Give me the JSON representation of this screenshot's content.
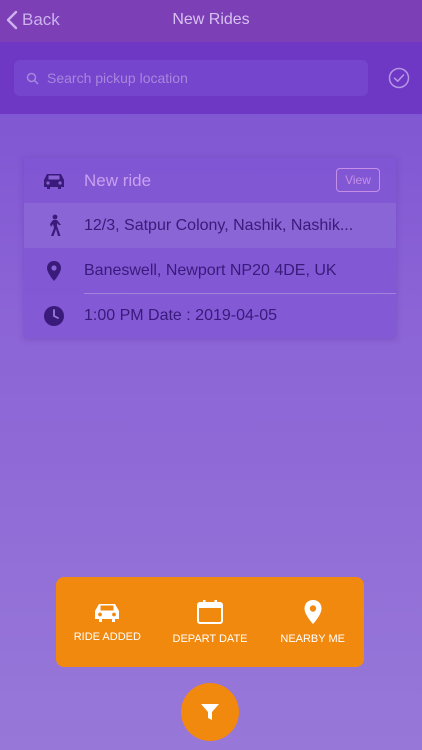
{
  "nav": {
    "back_label": "Back",
    "title": "New Rides"
  },
  "search": {
    "placeholder": "Search pickup location"
  },
  "ride": {
    "header": "New ride",
    "view_label": "View",
    "pickup": "12/3, Satpur Colony, Nashik, Nashik...",
    "drop": "Baneswell, Newport NP20 4DE, UK",
    "time": "1:00 PM Date : 2019-04-05"
  },
  "filters": {
    "ride_added": "RIDE ADDED",
    "depart_date": "DEPART DATE",
    "nearby_me": "NEARBY ME"
  },
  "colors": {
    "accent": "#f2890f",
    "nav": "#7c3fb5",
    "icon": "#3a1a7a"
  }
}
